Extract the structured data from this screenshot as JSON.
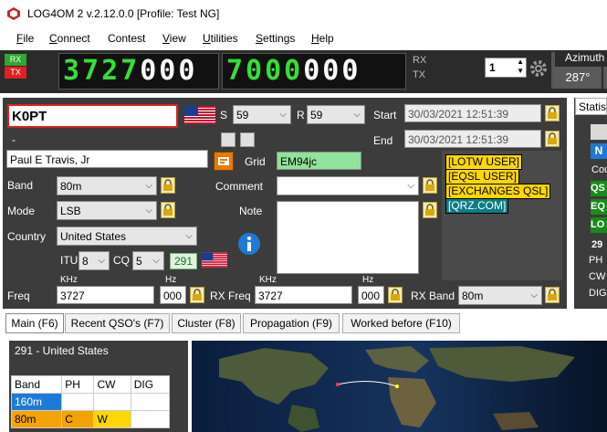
{
  "window": {
    "title": "LOG4OM 2 v.2.12.0.0 [Profile: Test NG]"
  },
  "menu": [
    {
      "label": "File",
      "mnemonic": "F",
      "rest": "ile"
    },
    {
      "label": "Connect",
      "mnemonic": "C",
      "rest": "onnect"
    },
    {
      "label": "Contest",
      "mnemonic": "",
      "rest": "Contest"
    },
    {
      "label": "View",
      "mnemonic": "V",
      "rest": "iew"
    },
    {
      "label": "Utilities",
      "mnemonic": "U",
      "rest": "tilities"
    },
    {
      "label": "Settings",
      "mnemonic": "S",
      "rest": "ettings"
    },
    {
      "label": "Help",
      "mnemonic": "H",
      "rest": "elp"
    }
  ],
  "radio": {
    "rx_tag": "RX",
    "tx_tag": "TX",
    "freq_main_bright": "3727",
    "freq_main_dim": "000",
    "freq_second_bright": "7000",
    "freq_second_dim": "000",
    "rx_label": "RX",
    "tx_label": "TX",
    "radio_number": "1",
    "azimuth_label": "Azimuth",
    "azimuth_value": "287°"
  },
  "qso": {
    "callsign": "K0PT",
    "dash": "-",
    "name": "Paul E Travis, Jr",
    "s_label": "S",
    "s_value": "59",
    "r_label": "R",
    "r_value": "59",
    "start_label": "Start",
    "start_value": "30/03/2021 12:51:39",
    "end_label": "End",
    "end_value": "30/03/2021 12:51:39",
    "band_label": "Band",
    "band_value": "80m",
    "mode_label": "Mode",
    "mode_value": "LSB",
    "country_label": "Country",
    "country_value": "United States",
    "itu_label": "ITU",
    "itu_value": "8",
    "cq_label": "CQ",
    "cq_value": "5",
    "dxcc_number": "291",
    "grid_label": "Grid",
    "grid_value": "EM94jc",
    "comment_label": "Comment",
    "comment_value": "",
    "note_label": "Note",
    "note_value": "",
    "freq_label": "Freq",
    "freq_unit": "KHz",
    "freq_value": "3727",
    "hz_unit": "Hz",
    "freq_hz": "000",
    "rxfreq_label": "RX Freq",
    "rxfreq_unit": "KHz",
    "rxfreq_value": "3727",
    "rxfreq_hz_unit": "Hz",
    "rxfreq_hz": "000",
    "rxband_label": "RX Band",
    "rxband_value": "80m"
  },
  "badges": [
    "[LOTW USER]",
    "[EQSL USER]",
    "[EXCHANGES QSL]",
    "[QRZ.COM]"
  ],
  "stats": {
    "tab_label": "Statis",
    "row_labels": [
      "Cou",
      "29",
      "PH",
      "CW",
      "DIG"
    ],
    "green_labels": [
      "QS",
      "EQ",
      "LO"
    ],
    "blue_label": "N"
  },
  "tabs": [
    "Main (F6)",
    "Recent QSO's (F7)",
    "Cluster (F8)",
    "Propagation (F9)",
    "Worked before (F10)"
  ],
  "worked": {
    "header": "291 - United States",
    "columns": [
      "Band",
      "PH",
      "CW",
      "DIG"
    ],
    "rows": [
      {
        "band": "160m",
        "ph": "",
        "cw": "",
        "dig": ""
      },
      {
        "band": "80m",
        "ph": "C",
        "cw": "W",
        "dig": ""
      }
    ]
  },
  "colors": {
    "accent_blue": "#1e7ad8",
    "lcd_green": "#35e035",
    "badge_yellow": "#ffd700",
    "qrz_teal": "#0b7d86"
  }
}
